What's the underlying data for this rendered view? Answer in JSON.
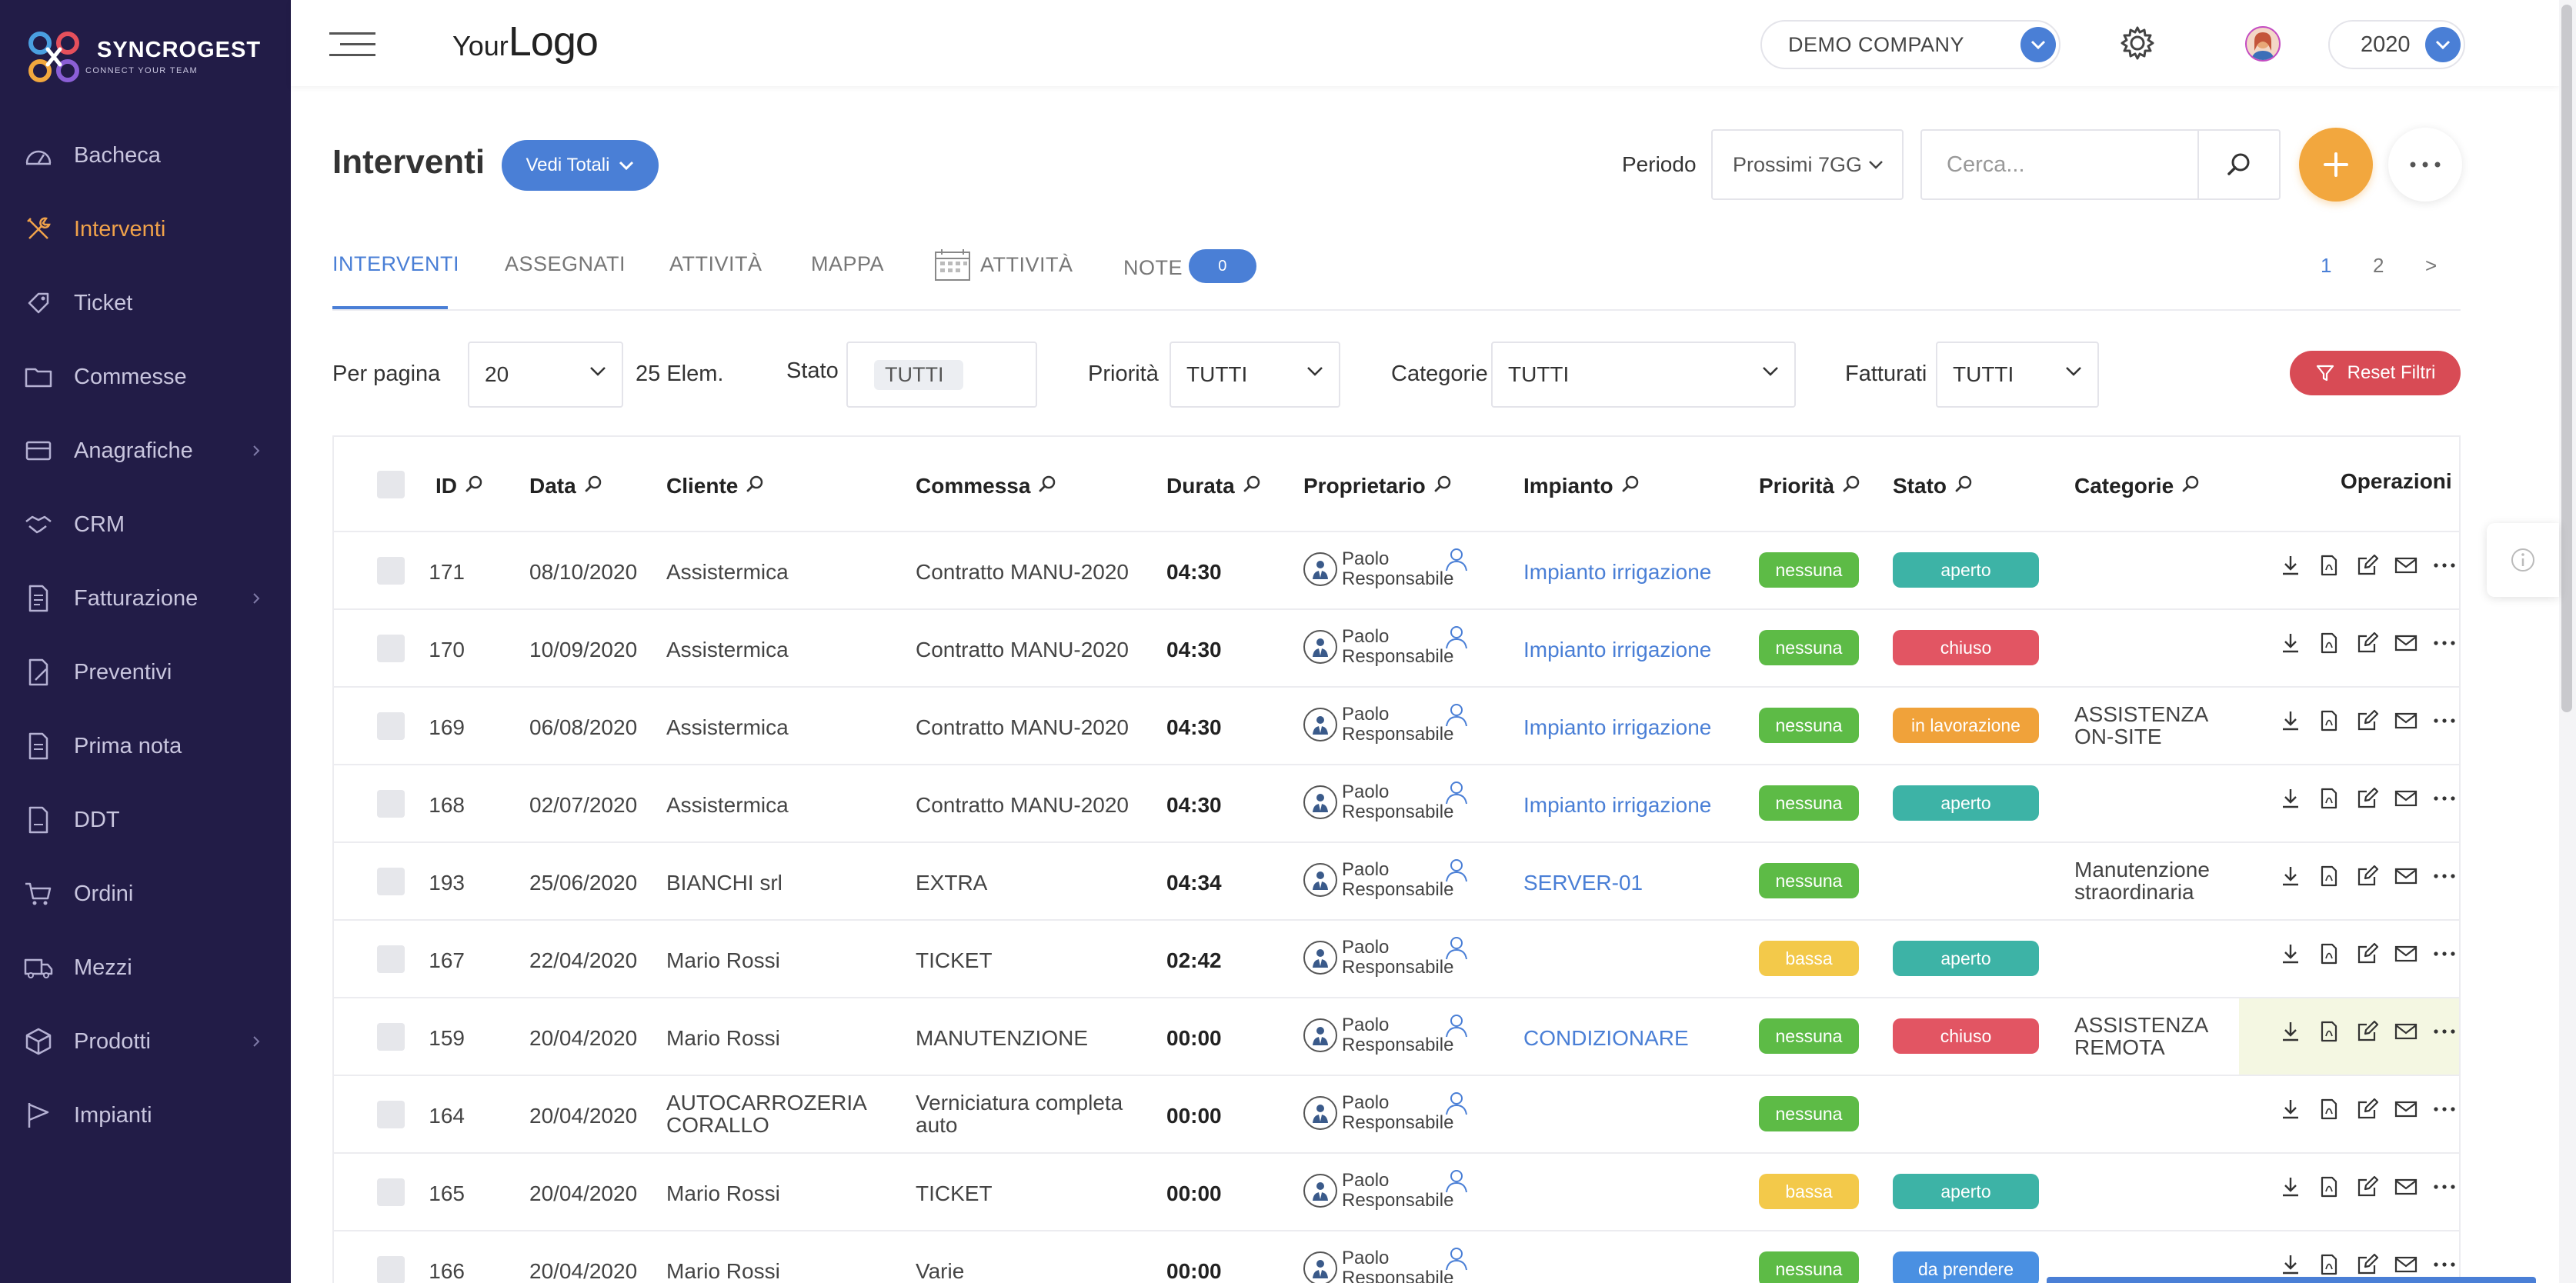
{
  "brand": {
    "name": "SYNCROGEST",
    "tagline": "CONNECT YOUR TEAM"
  },
  "sidebar": {
    "items": [
      {
        "label": "Bacheca",
        "icon": "dashboard-icon"
      },
      {
        "label": "Interventi",
        "icon": "tools-icon",
        "active": true
      },
      {
        "label": "Ticket",
        "icon": "ticket-icon"
      },
      {
        "label": "Commesse",
        "icon": "folder-icon"
      },
      {
        "label": "Anagrafiche",
        "icon": "contacts-icon",
        "has_children": true
      },
      {
        "label": "CRM",
        "icon": "handshake-icon"
      },
      {
        "label": "Fatturazione",
        "icon": "invoice-icon",
        "has_children": true
      },
      {
        "label": "Preventivi",
        "icon": "quote-icon"
      },
      {
        "label": "Prima nota",
        "icon": "ledger-icon"
      },
      {
        "label": "DDT",
        "icon": "ddt-document-icon"
      },
      {
        "label": "Ordini",
        "icon": "cart-icon"
      },
      {
        "label": "Mezzi",
        "icon": "truck-icon"
      },
      {
        "label": "Prodotti",
        "icon": "box-icon",
        "has_children": true
      },
      {
        "label": "Impianti",
        "icon": "flag-icon"
      }
    ]
  },
  "topbar": {
    "logo_your": "Your",
    "logo_logo": "Logo",
    "company": "DEMO COMPANY",
    "year": "2020"
  },
  "page": {
    "title": "Interventi",
    "totals_button": "Vedi Totali",
    "period_label": "Periodo",
    "period_value": "Prossimi 7GG",
    "search_placeholder": "Cerca..."
  },
  "tabs": [
    {
      "label": "INTERVENTI",
      "active": true
    },
    {
      "label": "ASSEGNATI"
    },
    {
      "label": "ATTIVITÀ"
    },
    {
      "label": "MAPPA"
    },
    {
      "label": "ATTIVITÀ",
      "icon": "calendar-icon"
    },
    {
      "label": "NOTE",
      "badge": "0"
    }
  ],
  "pagination": {
    "pages": [
      "1",
      "2"
    ],
    "next": ">",
    "current": "1"
  },
  "filters": {
    "per_page_label": "Per pagina",
    "per_page_value": "20",
    "elements": "25 Elem.",
    "stato_label": "Stato",
    "stato_value": "TUTTI",
    "priorita_label": "Priorità",
    "priorita_value": "TUTTI",
    "categorie_label": "Categorie",
    "categorie_value": "TUTTI",
    "fatturati_label": "Fatturati",
    "fatturati_value": "TUTTI",
    "reset_label": "Reset Filtri"
  },
  "table": {
    "columns": [
      "ID",
      "Data",
      "Cliente",
      "Commessa",
      "Durata",
      "Proprietario",
      "Impianto",
      "Priorità",
      "Stato",
      "Categorie",
      "Operazioni"
    ],
    "rows": [
      {
        "id": "171",
        "data": "08/10/2020",
        "cliente": "Assistermica",
        "commessa": "Contratto MANU-2020",
        "durata": "04:30",
        "owner1": "Paolo",
        "owner2": "Responsabile",
        "impianto": "Impianto irrigazione",
        "priorita": "nessuna",
        "stato": "aperto",
        "categorie": ""
      },
      {
        "id": "170",
        "data": "10/09/2020",
        "cliente": "Assistermica",
        "commessa": "Contratto MANU-2020",
        "durata": "04:30",
        "owner1": "Paolo",
        "owner2": "Responsabile",
        "impianto": "Impianto irrigazione",
        "priorita": "nessuna",
        "stato": "chiuso",
        "categorie": ""
      },
      {
        "id": "169",
        "data": "06/08/2020",
        "cliente": "Assistermica",
        "commessa": "Contratto MANU-2020",
        "durata": "04:30",
        "owner1": "Paolo",
        "owner2": "Responsabile",
        "impianto": "Impianto irrigazione",
        "priorita": "nessuna",
        "stato": "in lavorazione",
        "categorie": "ASSISTENZA ON-SITE"
      },
      {
        "id": "168",
        "data": "02/07/2020",
        "cliente": "Assistermica",
        "commessa": "Contratto MANU-2020",
        "durata": "04:30",
        "owner1": "Paolo",
        "owner2": "Responsabile",
        "impianto": "Impianto irrigazione",
        "priorita": "nessuna",
        "stato": "aperto",
        "categorie": ""
      },
      {
        "id": "193",
        "data": "25/06/2020",
        "cliente": "BIANCHI srl",
        "commessa": "EXTRA",
        "durata": "04:34",
        "owner1": "Paolo",
        "owner2": "Responsabile",
        "impianto": "SERVER-01",
        "priorita": "nessuna",
        "stato": "",
        "categorie": "Manutenzione straordinaria"
      },
      {
        "id": "167",
        "data": "22/04/2020",
        "cliente": "Mario Rossi",
        "commessa": "TICKET",
        "durata": "02:42",
        "owner1": "Paolo",
        "owner2": "Responsabile",
        "impianto": "",
        "priorita": "bassa",
        "stato": "aperto",
        "categorie": ""
      },
      {
        "id": "159",
        "data": "20/04/2020",
        "cliente": "Mario Rossi",
        "commessa": "MANUTENZIONE",
        "durata": "00:00",
        "owner1": "Paolo",
        "owner2": "Responsabile",
        "impianto": "CONDIZIONARE",
        "priorita": "nessuna",
        "stato": "chiuso",
        "categorie": "ASSISTENZA REMOTA",
        "highlight": true
      },
      {
        "id": "164",
        "data": "20/04/2020",
        "cliente": "AUTOCARROZERIA CORALLO",
        "commessa": "Verniciatura completa auto",
        "durata": "00:00",
        "owner1": "Paolo",
        "owner2": "Responsabile",
        "impianto": "",
        "priorita": "nessuna",
        "stato": "",
        "categorie": ""
      },
      {
        "id": "165",
        "data": "20/04/2020",
        "cliente": "Mario Rossi",
        "commessa": "TICKET",
        "durata": "00:00",
        "owner1": "Paolo",
        "owner2": "Responsabile",
        "impianto": "",
        "priorita": "bassa",
        "stato": "aperto",
        "categorie": ""
      },
      {
        "id": "166",
        "data": "20/04/2020",
        "cliente": "Mario Rossi",
        "commessa": "Varie",
        "durata": "00:00",
        "owner1": "Paolo",
        "owner2": "Responsabile",
        "impianto": "",
        "priorita": "nessuna",
        "stato": "da prendere",
        "categorie": ""
      }
    ]
  },
  "colors": {
    "sidebar_bg": "#221c47",
    "accent_blue": "#4a7fd6",
    "accent_orange": "#f2a73e",
    "priority_nessuna": "#5dbb46",
    "priority_bassa": "#f3c94a",
    "stato_aperto": "#3db3a6",
    "stato_chiuso": "#e25563",
    "stato_in_lavorazione": "#f0a23a",
    "stato_da_prendere": "#4a90e2",
    "reset_button": "#d84b55"
  }
}
